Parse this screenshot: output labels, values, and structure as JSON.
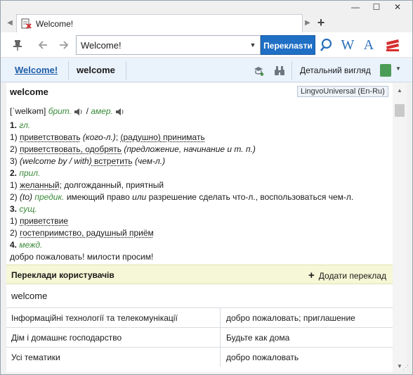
{
  "tab": {
    "title": "Welcome!"
  },
  "window_controls": {
    "minimize": "—",
    "maximize": "☐",
    "close": "✕"
  },
  "toolbar": {
    "search_value": "Welcome!",
    "translate_label": "Переклasти",
    "tool_w": "W",
    "tool_a": "A"
  },
  "nav": {
    "history_link": "Welcome!",
    "current": "welcome",
    "detailed_view": "Детальний вигляд"
  },
  "article": {
    "headword": "welcome",
    "dictionary": "LingvoUniversal (En-Ru)",
    "transcription": "[ˈwelkəm]",
    "brit": "брит.",
    "slash": "/",
    "amer": "амер.",
    "senses": [
      {
        "num": "1.",
        "pos": "гл."
      },
      {
        "num": "2.",
        "pos": "прил."
      },
      {
        "num": "3.",
        "pos": "сущ."
      },
      {
        "num": "4.",
        "pos": "межд."
      }
    ],
    "l1_1_a": "1) ",
    "l1_1_b": "приветствовать",
    "l1_1_c": " (кого-л.)",
    "l1_1_d": "; ",
    "l1_1_e": "(радушно)",
    "l1_1_f": " принимать",
    "l1_2_a": "2) ",
    "l1_2_b": "приветствовать, одобрять",
    "l1_2_c": " (предложение, начинание и т. п.)",
    "l1_3_a": "3) ",
    "l1_3_b": "(welcome by / with)",
    "l1_3_c": " встретить",
    "l1_3_d": " (чем-л.)",
    "l2_1_a": "1) ",
    "l2_1_b": "желанный",
    "l2_1_c": "; долгожданный, приятный",
    "l2_2_a": "2) ",
    "l2_2_b": "(to)",
    "l2_2_c": " предик.",
    "l2_2_d": " имеющий право ",
    "l2_2_e": "или",
    "l2_2_f": " разрешение сделать что-л., воспользоваться чем-л.",
    "l3_1_a": "1) ",
    "l3_1_b": "приветствие",
    "l3_2_a": "2) ",
    "l3_2_b": "гостеприимство, радушный приём",
    "l4_1": "добро пожаловать! милости просим!"
  },
  "user_translations": {
    "title": "Переклади користувачів",
    "add_label": "Додати переклад",
    "add_plus": "+",
    "word": "welcome",
    "rows": [
      {
        "topic": "Інформаційні технології та телекомунікації",
        "translation": "добро пожаловать; приглашение"
      },
      {
        "topic": "Дім і домашнє господарство",
        "translation": "Будьте как дома"
      },
      {
        "topic": "Усі тематики",
        "translation": "добро пожаловать"
      }
    ]
  },
  "colors": {
    "accent": "#1f6fc5",
    "nav_bg": "#eaf2fb",
    "ut_header_bg": "#f6f7d6",
    "grammar": "#3a8a3a"
  },
  "icons": [
    "pin-icon",
    "back-arrow-icon",
    "forward-arrow-icon",
    "dropdown-icon",
    "search-icon",
    "wikipedia-icon",
    "font-icon",
    "lingvo-logo-icon",
    "add-card-icon",
    "binoculars-icon",
    "book-icon",
    "speaker-icon"
  ]
}
